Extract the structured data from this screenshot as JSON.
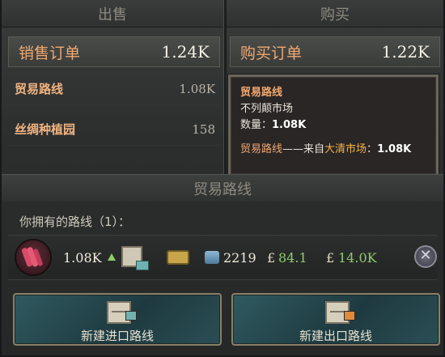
{
  "tabs": {
    "sell": "出售",
    "buy": "购买"
  },
  "sell": {
    "orders_label": "销售订单",
    "orders_value": "1.24K",
    "rows": [
      {
        "label": "贸易路线",
        "value": "1.08K"
      },
      {
        "label": "丝绸种植园",
        "value": "158"
      }
    ]
  },
  "buy": {
    "orders_label": "购买订单",
    "orders_value": "1.22K"
  },
  "tooltip": {
    "title": "贸易路线",
    "subtitle": "不列颠市场",
    "qty_label": "数量：",
    "qty_value": "1.08K",
    "line_prefix": "贸易路线",
    "line_mid": "——来自",
    "line_market": "大清市场",
    "line_colon": "：",
    "line_value": "1.08K"
  },
  "routes": {
    "header": "贸易路线",
    "owned_label": "你拥有的路线（1）：",
    "row": {
      "goods_icon": "silk-icon",
      "amount": "1.08K",
      "convoys": "2219",
      "price1": "84.1",
      "price2": "14.0K",
      "pound_symbol": "£"
    }
  },
  "buttons": {
    "import": "新建进口路线",
    "export": "新建出口路线"
  },
  "colors": {
    "accent_orange": "#f0a870",
    "positive_green": "#8ecb6a",
    "import_badge": "#6fb2b0",
    "export_badge": "#e08a3a"
  }
}
